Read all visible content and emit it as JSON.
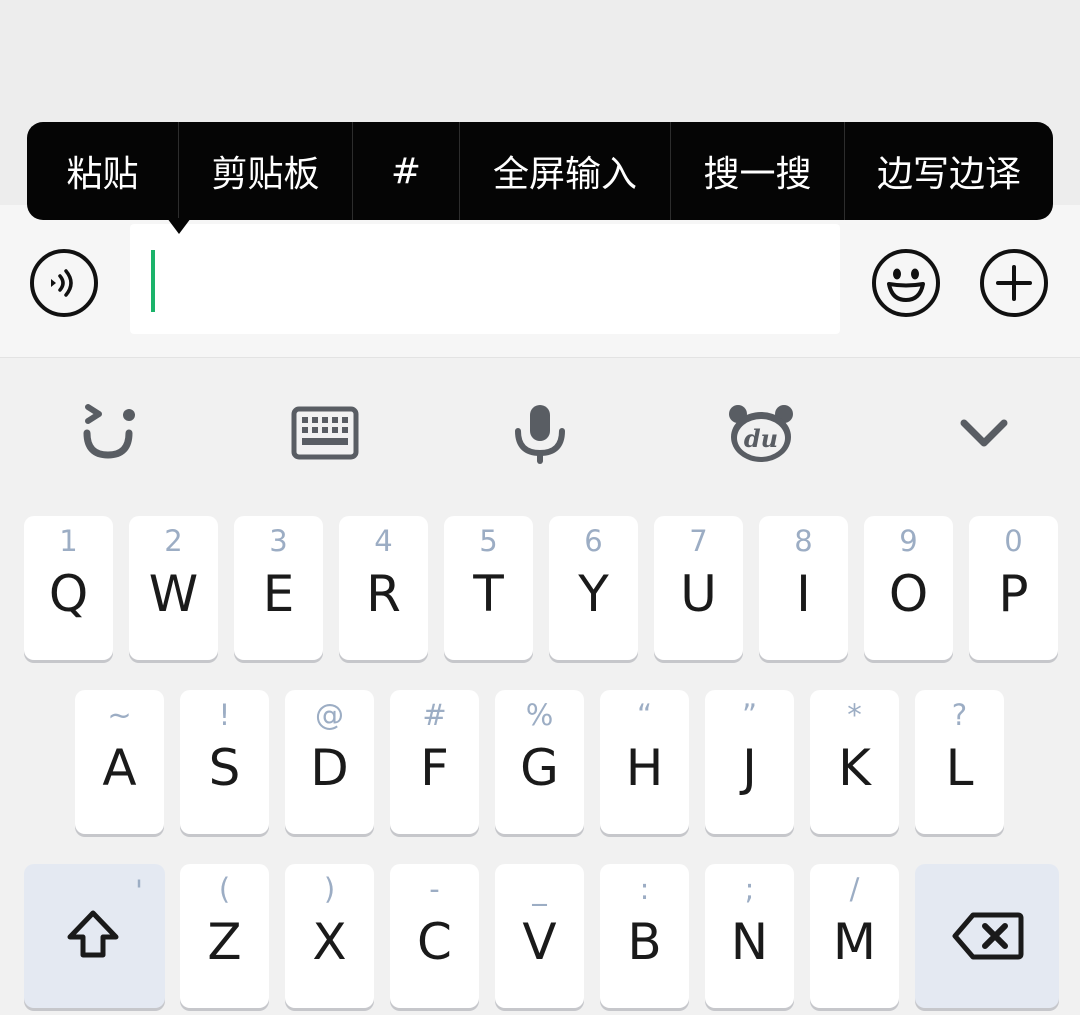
{
  "context_menu": {
    "items": [
      "粘贴",
      "剪贴板",
      "#",
      "全屏输入",
      "搜一搜",
      "边写边译"
    ]
  },
  "input": {
    "value": "",
    "caret_color": "#1bb36a"
  },
  "toolbar": {
    "icons": [
      "wink-face-icon",
      "keyboard-icon",
      "microphone-icon",
      "du-bear-icon",
      "chevron-down-icon"
    ],
    "logo_text": "du"
  },
  "keyboard": {
    "row1": [
      {
        "main": "Q",
        "sub": "1"
      },
      {
        "main": "W",
        "sub": "2"
      },
      {
        "main": "E",
        "sub": "3"
      },
      {
        "main": "R",
        "sub": "4"
      },
      {
        "main": "T",
        "sub": "5"
      },
      {
        "main": "Y",
        "sub": "6"
      },
      {
        "main": "U",
        "sub": "7"
      },
      {
        "main": "I",
        "sub": "8"
      },
      {
        "main": "O",
        "sub": "9"
      },
      {
        "main": "P",
        "sub": "0"
      }
    ],
    "row2": [
      {
        "main": "A",
        "sub": "~"
      },
      {
        "main": "S",
        "sub": "!"
      },
      {
        "main": "D",
        "sub": "@"
      },
      {
        "main": "F",
        "sub": "#"
      },
      {
        "main": "G",
        "sub": "%"
      },
      {
        "main": "H",
        "sub": "“"
      },
      {
        "main": "J",
        "sub": "”"
      },
      {
        "main": "K",
        "sub": "*"
      },
      {
        "main": "L",
        "sub": "?"
      }
    ],
    "row3": [
      {
        "main": "Z",
        "sub": "("
      },
      {
        "main": "X",
        "sub": ")"
      },
      {
        "main": "C",
        "sub": "-"
      },
      {
        "main": "V",
        "sub": "_"
      },
      {
        "main": "B",
        "sub": ":"
      },
      {
        "main": "N",
        "sub": ";"
      },
      {
        "main": "M",
        "sub": "/"
      }
    ],
    "shift_sub": "'"
  },
  "colors": {
    "menu_bg": "#050505",
    "key_bg": "#ffffff",
    "special_key_bg": "#e4e9f2",
    "hint": "#9cadc4"
  }
}
